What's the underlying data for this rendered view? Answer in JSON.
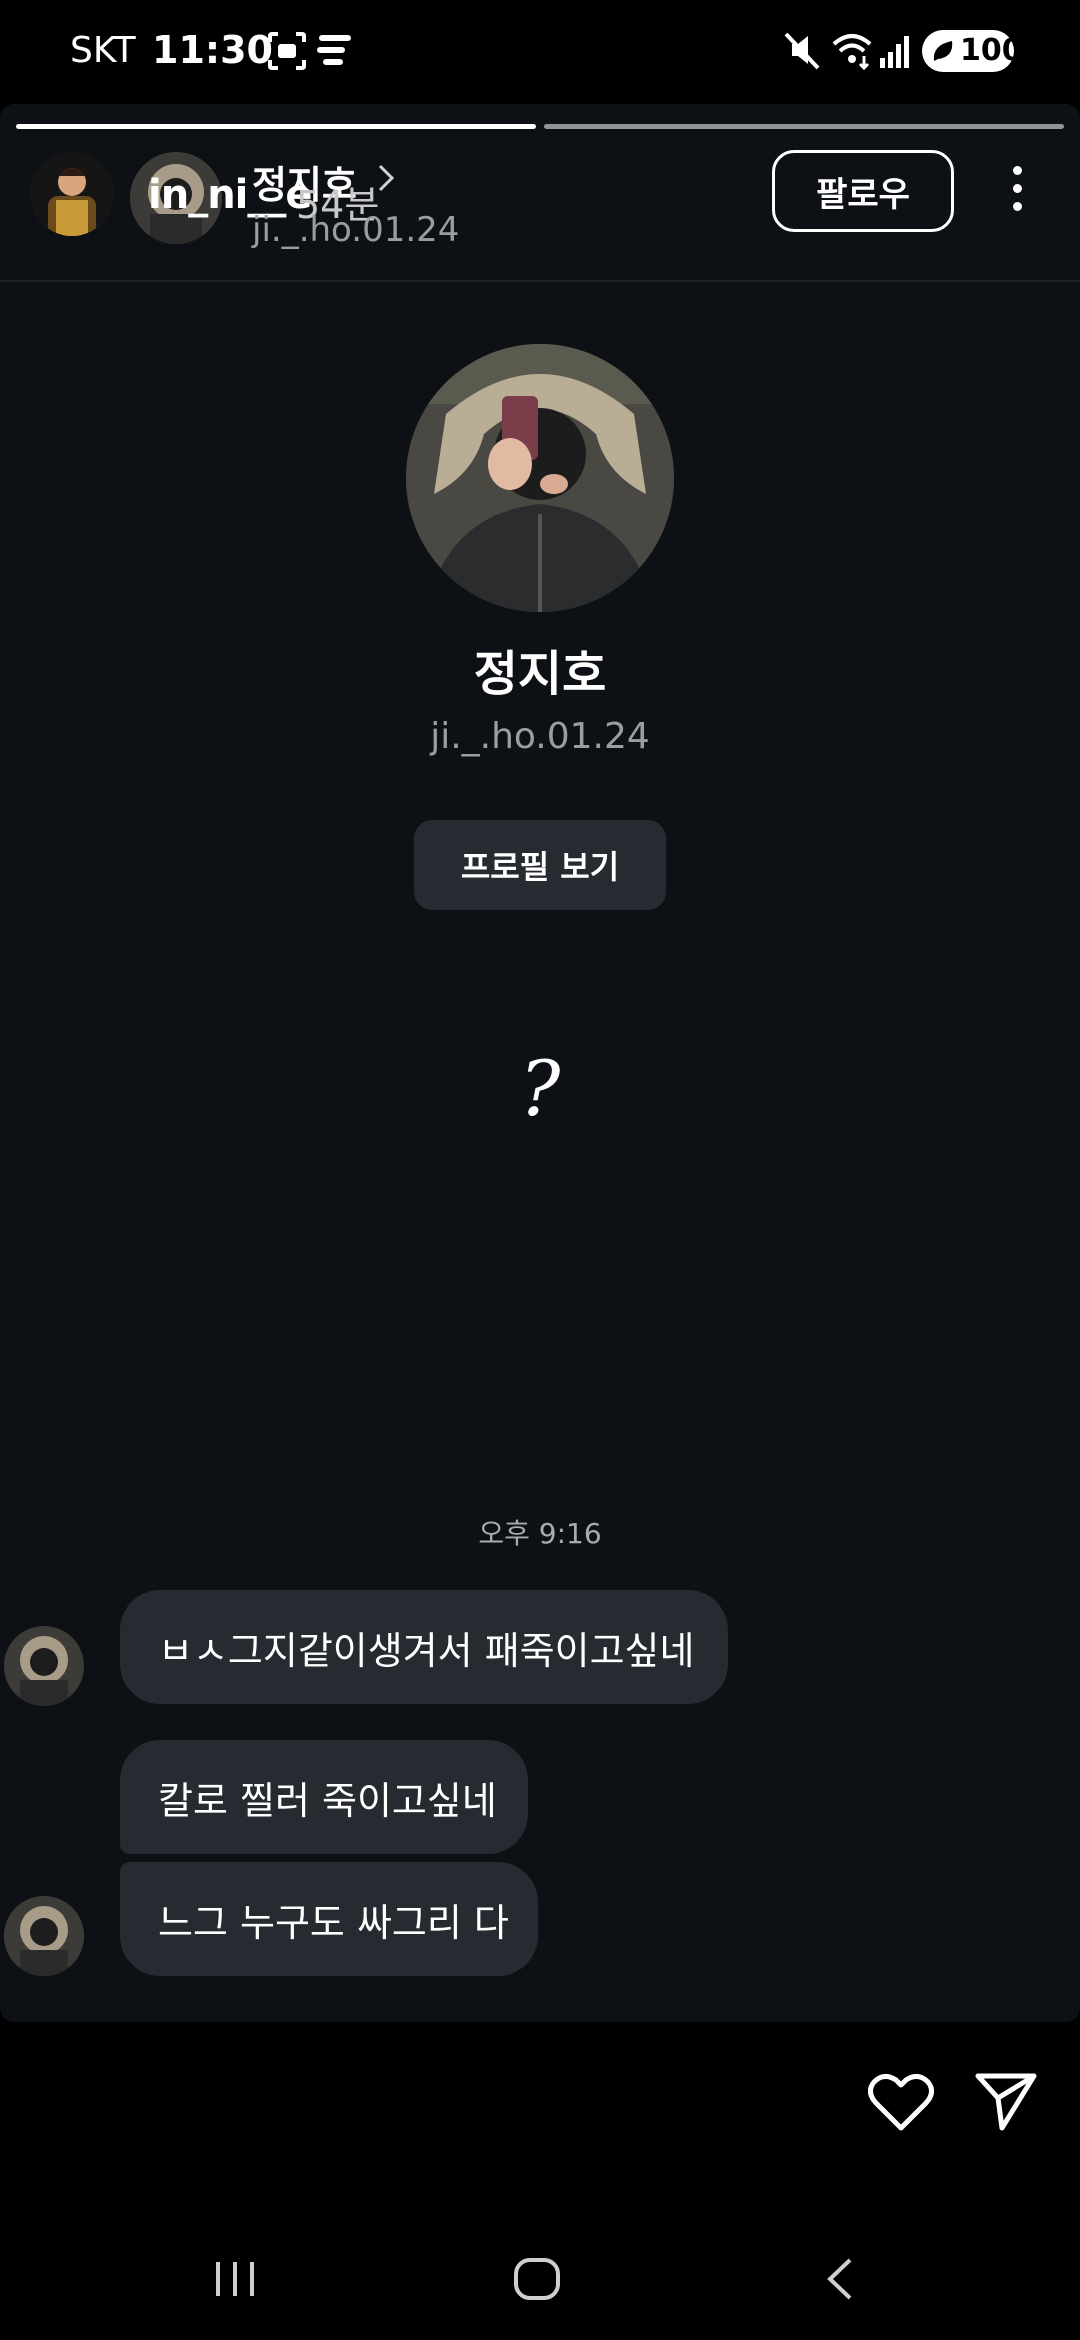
{
  "status_bar": {
    "carrier": "SKT",
    "time": "11:30",
    "battery": "100"
  },
  "story_header": {
    "username": "in_ni__e",
    "time_ago": "54분",
    "shared_profile_name": "정지호",
    "shared_profile_handle": "ji._.ho.01.24",
    "follow_label": "팔로우"
  },
  "profile_card": {
    "name": "정지호",
    "handle": "ji._.ho.01.24",
    "view_profile_label": "프로필 보기"
  },
  "story_text": "?",
  "chat": {
    "timestamp": "오후 9:16",
    "messages": [
      {
        "text": "ㅂㅅ그지같이생겨서 패죽이고싶네"
      },
      {
        "text": "칼로 찔러 죽이고싶네"
      },
      {
        "text": "느그 누구도 싸그리 다"
      }
    ]
  },
  "icons": {
    "mute": "mute-icon",
    "wifi": "wifi-icon",
    "signal": "signal-icon",
    "heart": "heart-icon",
    "send": "send-icon",
    "more": "more-vertical-icon"
  },
  "colors": {
    "background": "#000000",
    "story_bg": "#0d1014",
    "bubble_bg": "#262a31",
    "secondary_text": "#9a9ea4"
  }
}
